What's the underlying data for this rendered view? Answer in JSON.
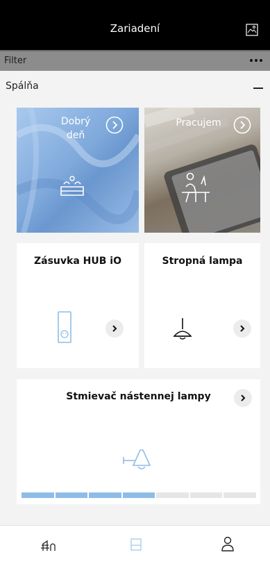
{
  "header": {
    "title": "Zariadení",
    "icon": "picture-frame-icon"
  },
  "filter": {
    "label": "Filter",
    "more_icon": "more-dots-icon"
  },
  "room": {
    "name": "Spálňa",
    "collapse_icon": "minus-icon"
  },
  "scenes": [
    {
      "title": "Dobrý\ndeň",
      "icon": "bed-icon",
      "bg": "#8fb6e2"
    },
    {
      "title": "Pracujem",
      "icon": "desk-worker-icon",
      "bg": "#a39c8d"
    }
  ],
  "devices": [
    {
      "title": "Zásuvka HUB iO",
      "icon": "socket-icon"
    },
    {
      "title": "Stropná lampa",
      "icon": "ceiling-lamp-icon"
    }
  ],
  "dimmer": {
    "title": "Stmievač nástennej lampy",
    "icon": "wall-lamp-icon",
    "level": 0.57,
    "segments": 7
  },
  "tabs": [
    {
      "name": "scenes",
      "icon": "scene-icon"
    },
    {
      "name": "devices",
      "icon": "devices-icon",
      "active": true
    },
    {
      "name": "profile",
      "icon": "user-icon"
    }
  ],
  "colors": {
    "accent": "#8fbce6",
    "track_off": "#e6e6e6",
    "header": "#000000",
    "filter_bar": "#8c8c8c"
  }
}
